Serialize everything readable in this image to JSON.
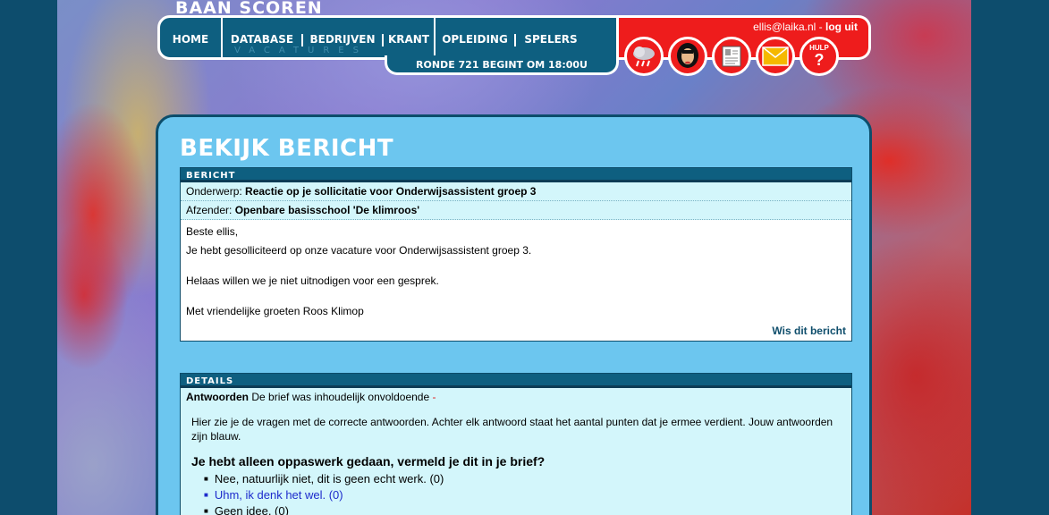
{
  "site": {
    "title": "BAAN SCOREN"
  },
  "nav": {
    "home": "HOME",
    "database": "DATABASE",
    "bedrijven": "BEDRIJVEN",
    "krant": "KRANT",
    "opleiding": "OPLEIDING",
    "spelers": "SPELERS",
    "vacatures": "VACATURES",
    "ronde": "RONDE 721 BEGINT OM 18:00U"
  },
  "user": {
    "email": "ellis@laika.nl",
    "separator": " - ",
    "logout": "log uit"
  },
  "icons": [
    "weather-icon",
    "avatar-icon",
    "profile-card-icon",
    "mail-icon",
    "help-icon"
  ],
  "help_label": "HULP",
  "help_mark": "?",
  "page": {
    "title": "BEKIJK BERICHT"
  },
  "bericht": {
    "header": "BERICHT",
    "onderwerp_label": "Onderwerp:",
    "onderwerp": "Reactie op je sollicitatie voor Onderwijsassistent groep 3",
    "afzender_label": "Afzender:",
    "afzender": "Openbare basisschool 'De klimroos'",
    "greeting": "Beste ellis,",
    "line1": "Je hebt gesolliciteerd op onze vacature voor Onderwijsassistent groep 3.",
    "line2": "Helaas willen we je niet uitnodigen voor een gesprek.",
    "closing": "Met vriendelijke groeten Roos Klimop",
    "delete": "Wis dit bericht"
  },
  "details": {
    "header": "DETAILS",
    "antwoorden_label": "Antwoorden",
    "antwoorden": "De brief was inhoudelijk onvoldoende",
    "dash": "-",
    "explain": "Hier zie je de vragen met de correcte antwoorden. Achter elk antwoord staat het aantal punten dat je ermee verdient. Jouw antwoorden zijn blauw.",
    "question": "Je hebt alleen oppaswerk gedaan, vermeld je dit in je brief?",
    "answers": [
      "Nee, natuurlijk niet, dit is geen echt werk. (0)",
      "Uhm, ik denk het wel. (0)",
      "Geen idee. (0)"
    ]
  },
  "colors": {
    "nav": "#0e5f80",
    "user_bar": "#ee1c1c",
    "panel": "#6cc6ef",
    "row": "#d3f6fb",
    "selected_answer": "#1d2bcc"
  }
}
